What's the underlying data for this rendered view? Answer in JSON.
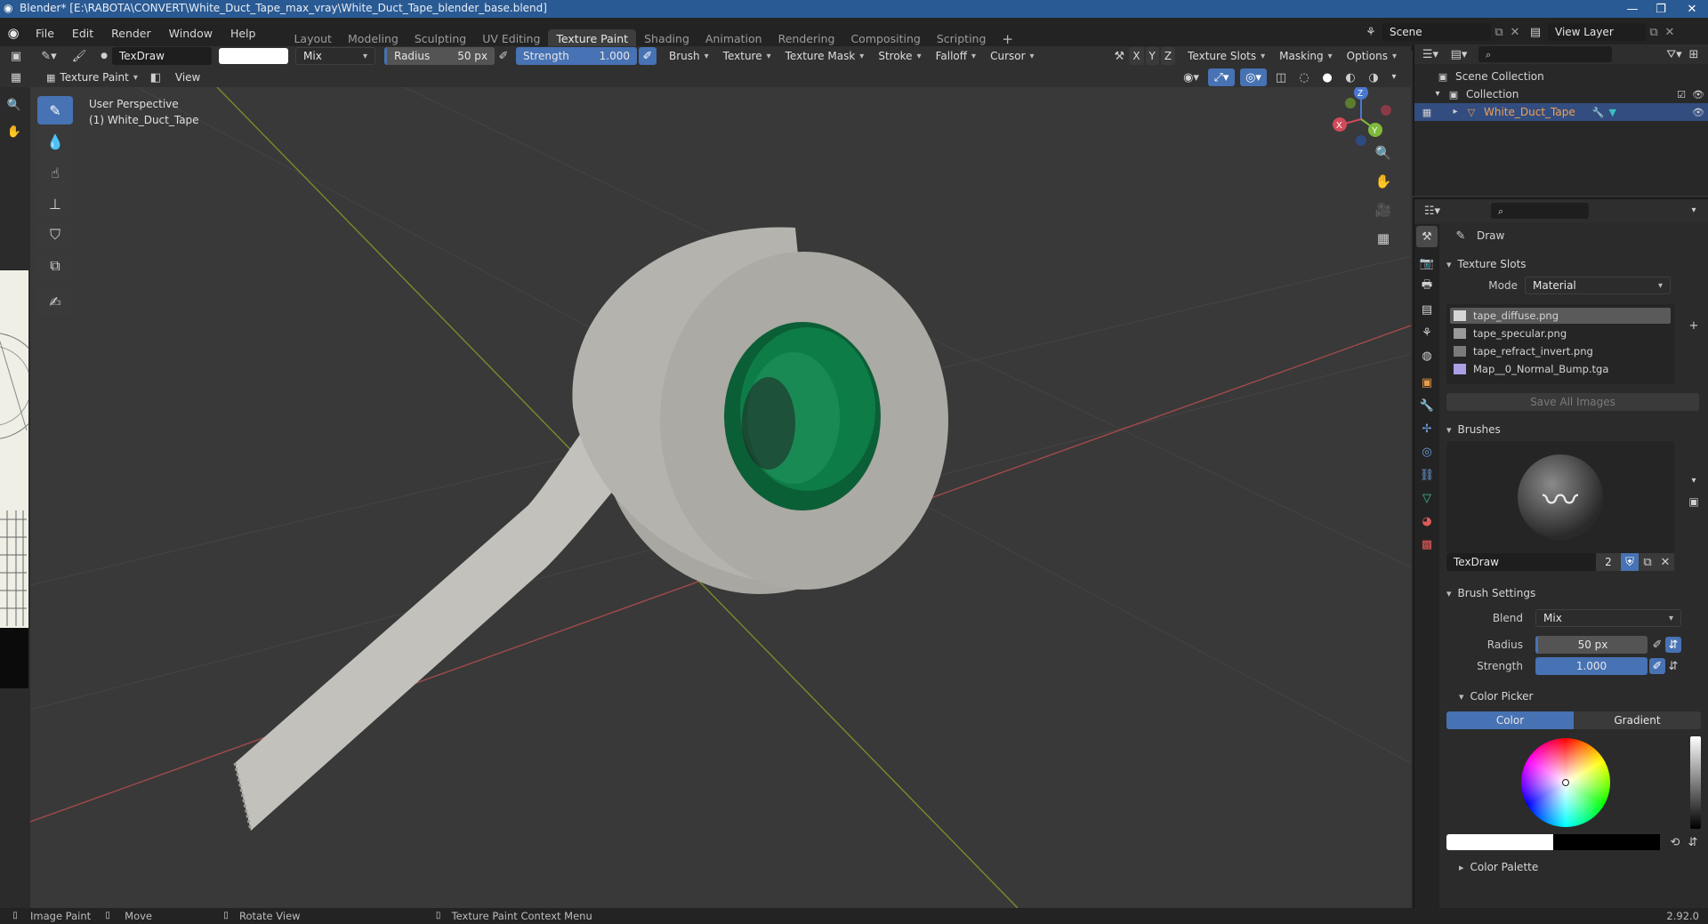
{
  "window": {
    "title": "Blender* [E:\\RABOTA\\CONVERT\\White_Duct_Tape_max_vray\\White_Duct_Tape_blender_base.blend]"
  },
  "menu": [
    "File",
    "Edit",
    "Render",
    "Window",
    "Help"
  ],
  "workspaces": [
    {
      "label": "Layout",
      "active": false
    },
    {
      "label": "Modeling",
      "active": false
    },
    {
      "label": "Sculpting",
      "active": false
    },
    {
      "label": "UV Editing",
      "active": false
    },
    {
      "label": "Texture Paint",
      "active": true
    },
    {
      "label": "Shading",
      "active": false
    },
    {
      "label": "Animation",
      "active": false
    },
    {
      "label": "Rendering",
      "active": false
    },
    {
      "label": "Compositing",
      "active": false
    },
    {
      "label": "Scripting",
      "active": false
    }
  ],
  "scene": {
    "name": "Scene",
    "view_layer": "View Layer"
  },
  "toolheader": {
    "brush_name": "TexDraw",
    "blend": "Mix",
    "radius_label": "Radius",
    "radius_value": "50 px",
    "strength_label": "Strength",
    "strength_value": "1.000",
    "menus": [
      "Brush",
      "Texture",
      "Texture Mask",
      "Stroke",
      "Falloff",
      "Cursor"
    ],
    "axes": [
      "X",
      "Y",
      "Z"
    ],
    "right_menus": [
      "Texture Slots",
      "Masking",
      "Options"
    ]
  },
  "viewheader": {
    "mode": "Texture Paint",
    "view": "View"
  },
  "viewport": {
    "perspective": "User Perspective",
    "object_label": "(1) White_Duct_Tape"
  },
  "outliner": {
    "scene_collection": "Scene Collection",
    "collection": "Collection",
    "object": "White_Duct_Tape"
  },
  "properties": {
    "tool_name": "Draw",
    "texture_slots_title": "Texture Slots",
    "mode_label": "Mode",
    "mode_value": "Material",
    "slots": [
      "tape_diffuse.png",
      "tape_specular.png",
      "tape_refract_invert.png",
      "Map__0_Normal_Bump.tga"
    ],
    "save_all": "Save All Images",
    "brushes_title": "Brushes",
    "brush_name": "TexDraw",
    "brush_users": "2",
    "brush_settings_title": "Brush Settings",
    "blend_label": "Blend",
    "blend_value": "Mix",
    "radius_label": "Radius",
    "radius_value": "50 px",
    "strength_label": "Strength",
    "strength_value": "1.000",
    "color_picker_title": "Color Picker",
    "color_tab": "Color",
    "gradient_tab": "Gradient",
    "color_palette_title": "Color Palette"
  },
  "statusbar": {
    "items": [
      "Image Paint",
      "Move",
      "Rotate View",
      "Texture Paint Context Menu"
    ],
    "version": "2.92.0"
  },
  "colors": {
    "accent": "#4772b3",
    "titlebar": "#2a5a93",
    "tape_white": "#bdbcb6",
    "tape_core": "#0d7a45"
  }
}
